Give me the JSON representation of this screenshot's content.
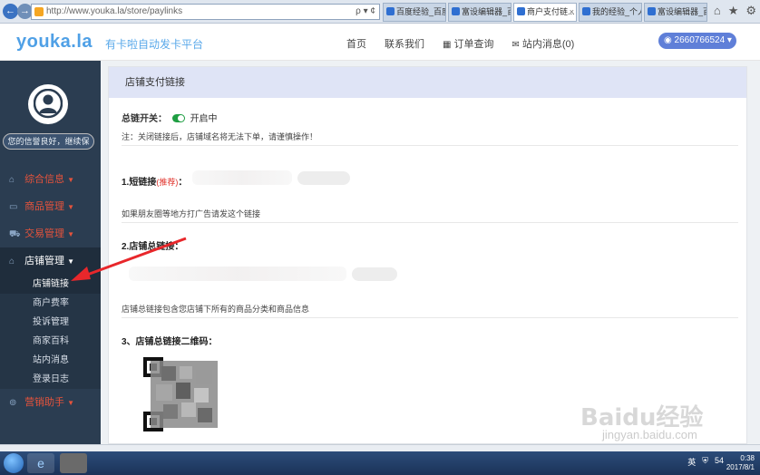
{
  "browser": {
    "url": "http://www.youka.la/store/paylinks",
    "addr_tools": "ρ ▾ ¢",
    "tabs": [
      {
        "label": "百度经验_百度..."
      },
      {
        "label": "富设编辑器_百..."
      },
      {
        "label": "商户支付链..."
      },
      {
        "label": "我的经验_个人..."
      },
      {
        "label": "富设编辑器_百..."
      }
    ],
    "icons": [
      "home-icon",
      "star-icon",
      "settings-icon"
    ]
  },
  "header": {
    "logo": "youka.la",
    "slogan": "有卡啦自动发卡平台",
    "nav": [
      {
        "label": "首页",
        "icon": ""
      },
      {
        "label": "联系我们",
        "icon": ""
      },
      {
        "label": "订单查询",
        "icon": "▦"
      },
      {
        "label": "站内消息(0)",
        "icon": "✉"
      }
    ],
    "user_id": "2660766524"
  },
  "sidebar": {
    "credit_text": "您的信誉良好，继续保",
    "menu": [
      {
        "label": "综合信息",
        "icon": "⌂"
      },
      {
        "label": "商品管理",
        "icon": "▭"
      },
      {
        "label": "交易管理",
        "icon": "⛟"
      },
      {
        "label": "店铺管理",
        "icon": "⌂"
      }
    ],
    "submenu": [
      {
        "label": "店铺链接"
      },
      {
        "label": "商户费率"
      },
      {
        "label": "投诉管理"
      },
      {
        "label": "商家百科"
      },
      {
        "label": "站内消息"
      },
      {
        "label": "登录日志"
      }
    ],
    "menu_last": {
      "label": "营销助手",
      "icon": "⊚"
    }
  },
  "content": {
    "panel_title": "店铺支付链接",
    "switch_label": "总链开关：",
    "switch_state": "开启中",
    "switch_note": "注：关闭链接后，店铺域名将无法下单，请谨慎操作！",
    "short_link_title": "1.短链接",
    "short_link_rec": "(推荐)",
    "short_link_colon": "：",
    "short_link_note": "如果朋友圈等地方打广告请发这个链接",
    "full_link_title": "2.店铺总链接：",
    "full_link_note": "店铺总链接包含您店铺下所有的商品分类和商品信息",
    "qr_title": "3、店铺总链接二维码："
  },
  "watermark": {
    "brand": "Baidu经验",
    "sub": "jingyan.baidu.com"
  },
  "taskbar": {
    "tray_lang": "英",
    "tray_num": "54",
    "time": "0:38",
    "date": "2017/8/1"
  }
}
